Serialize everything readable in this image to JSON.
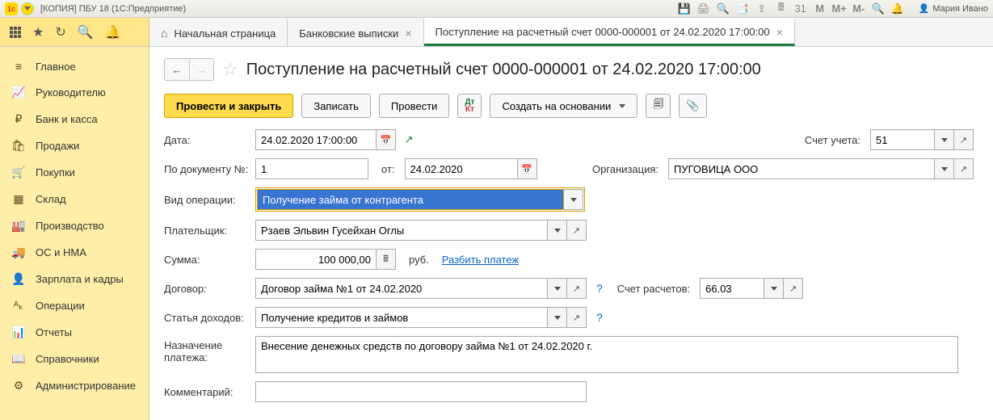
{
  "titlebar": {
    "title": "[КОПИЯ] ПБУ 18  (1С:Предприятие)",
    "user": "Мария Ивано"
  },
  "tabs": {
    "home": "Начальная страница",
    "t1": "Банковские выписки",
    "t2": "Поступление на расчетный счет 0000-000001 от 24.02.2020 17:00:00"
  },
  "sidebar": {
    "items": [
      {
        "icon": "≡",
        "label": "Главное"
      },
      {
        "icon": "📈",
        "label": "Руководителю"
      },
      {
        "icon": "₽",
        "label": "Банк и касса"
      },
      {
        "icon": "🛍",
        "label": "Продажи"
      },
      {
        "icon": "🛒",
        "label": "Покупки"
      },
      {
        "icon": "▦",
        "label": "Склад"
      },
      {
        "icon": "🏭",
        "label": "Производство"
      },
      {
        "icon": "🚚",
        "label": "ОС и НМА"
      },
      {
        "icon": "👤",
        "label": "Зарплата и кадры"
      },
      {
        "icon": "ᴬₖ",
        "label": "Операции"
      },
      {
        "icon": "📊",
        "label": "Отчеты"
      },
      {
        "icon": "📖",
        "label": "Справочники"
      },
      {
        "icon": "⚙",
        "label": "Администрирование"
      }
    ]
  },
  "page": {
    "title": "Поступление на расчетный счет 0000-000001 от 24.02.2020 17:00:00"
  },
  "toolbar": {
    "post_close": "Провести и закрыть",
    "save": "Записать",
    "post": "Провести",
    "create_based": "Создать на основании"
  },
  "form": {
    "labels": {
      "date": "Дата:",
      "doc_no": "По документу №:",
      "from": "от:",
      "op_type": "Вид операции:",
      "payer": "Плательщик:",
      "sum": "Сумма:",
      "rub": "руб.",
      "split": "Разбить платеж",
      "contract": "Договор:",
      "income_item": "Статья доходов:",
      "purpose": "Назначение платежа:",
      "comment": "Комментарий:",
      "account": "Счет учета:",
      "org": "Организация:",
      "calc_account": "Счет расчетов:"
    },
    "values": {
      "date": "24.02.2020 17:00:00",
      "doc_no": "1",
      "doc_date": "24.02.2020",
      "op_type": "Получение займа от контрагента",
      "payer": "Рзаев Эльвин Гусейхан Оглы",
      "sum": "100 000,00",
      "contract": "Договор займа №1 от 24.02.2020",
      "income_item": "Получение кредитов и займов",
      "purpose": "Внесение денежных средств по договору займа №1 от 24.02.2020 г.",
      "comment": "",
      "account": "51",
      "org": "ПУГОВИЦА ООО",
      "calc_account": "66.03"
    }
  }
}
